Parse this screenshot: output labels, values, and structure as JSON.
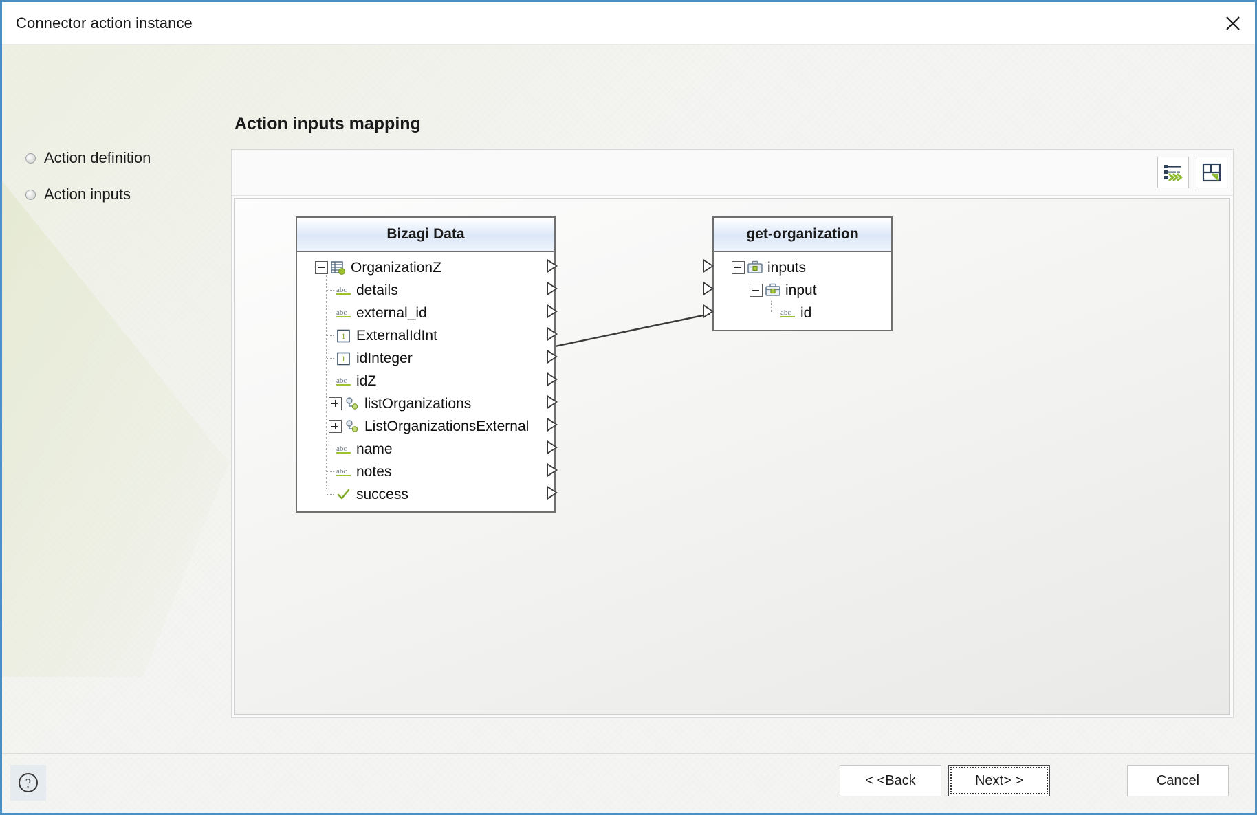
{
  "window": {
    "title": "Connector action instance",
    "close_icon": "close-icon"
  },
  "sidebar": {
    "items": [
      {
        "label": "Action definition"
      },
      {
        "label": "Action inputs"
      }
    ]
  },
  "main": {
    "heading": "Action inputs mapping",
    "toolbar": {
      "automap_icon": "auto-map-icon",
      "save_icon": "save-mapping-icon"
    }
  },
  "mapping": {
    "source_node": {
      "title": "Bizagi Data",
      "rows": [
        {
          "label": "OrganizationZ",
          "icon": "entity-icon",
          "expander": "minus",
          "indent": 0
        },
        {
          "label": "details",
          "icon": "string-abc-icon",
          "expander": "none",
          "indent": 1
        },
        {
          "label": "external_id",
          "icon": "string-abc-icon",
          "expander": "none",
          "indent": 1
        },
        {
          "label": "ExternalIdInt",
          "icon": "integer-icon",
          "expander": "none",
          "indent": 1
        },
        {
          "label": "idInteger",
          "icon": "integer-icon",
          "expander": "none",
          "indent": 1
        },
        {
          "label": "idZ",
          "icon": "string-abc-icon",
          "expander": "none",
          "indent": 1
        },
        {
          "label": "listOrganizations",
          "icon": "collection-icon",
          "expander": "plus",
          "indent": 1
        },
        {
          "label": "ListOrganizationsExternal",
          "icon": "collection-icon",
          "expander": "plus",
          "indent": 1
        },
        {
          "label": "name",
          "icon": "string-abc-icon",
          "expander": "none",
          "indent": 1
        },
        {
          "label": "notes",
          "icon": "string-abc-icon",
          "expander": "none",
          "indent": 1
        },
        {
          "label": "success",
          "icon": "boolean-check-icon",
          "expander": "none",
          "indent": 1
        }
      ]
    },
    "target_node": {
      "title": "get-organization",
      "rows": [
        {
          "label": "inputs",
          "icon": "briefcase-icon",
          "expander": "minus",
          "indent": 0
        },
        {
          "label": "input",
          "icon": "briefcase-icon",
          "expander": "minus",
          "indent": 1
        },
        {
          "label": "id",
          "icon": "string-abc-icon",
          "expander": "none",
          "indent": 2
        }
      ]
    },
    "connections": [
      {
        "from": "idInteger",
        "to": "id"
      }
    ]
  },
  "footer": {
    "help_icon": "help-icon",
    "back_label": "< <Back",
    "next_label": "Next> >",
    "cancel_label": "Cancel"
  },
  "colors": {
    "accent_border": "#4a90c4",
    "header_gradient": "#dce7f7",
    "icon_green": "#8cb82b",
    "node_border": "#6f6f6f"
  }
}
